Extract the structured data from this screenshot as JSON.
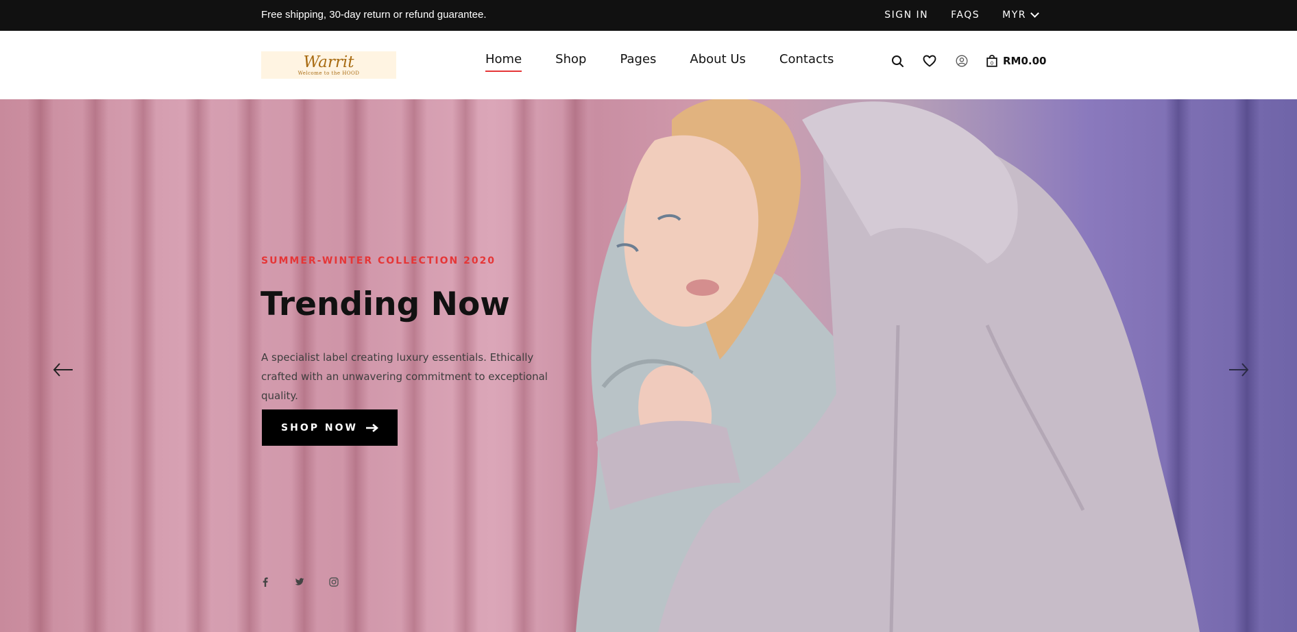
{
  "topbar": {
    "promo": "Free shipping, 30-day return or refund guarantee.",
    "sign_in": "SIGN IN",
    "faqs": "FAQS",
    "currency": "MYR"
  },
  "header": {
    "logo_text": "Warrit",
    "logo_tagline": "Welcome to the HOOD",
    "nav": [
      {
        "label": "Home",
        "active": true
      },
      {
        "label": "Shop",
        "active": false
      },
      {
        "label": "Pages",
        "active": false
      },
      {
        "label": "About Us",
        "active": false
      },
      {
        "label": "Contacts",
        "active": false
      }
    ],
    "icons": [
      "search-icon",
      "heart-icon",
      "user-icon",
      "bag-icon"
    ],
    "cart_count": "0",
    "cart_total": "RM0.00"
  },
  "hero": {
    "subtitle": "SUMMER-WINTER COLLECTION 2020",
    "title": "Trending Now",
    "description": "A specialist label creating luxury essentials. Ethically crafted with an unwavering commitment to exceptional quality.",
    "button_label": "SHOP NOW",
    "social": [
      "facebook-icon",
      "twitter-icon",
      "instagram-icon"
    ]
  },
  "colors": {
    "accent": "#e53637",
    "topbar_bg": "#111111",
    "button_bg": "#000000"
  }
}
